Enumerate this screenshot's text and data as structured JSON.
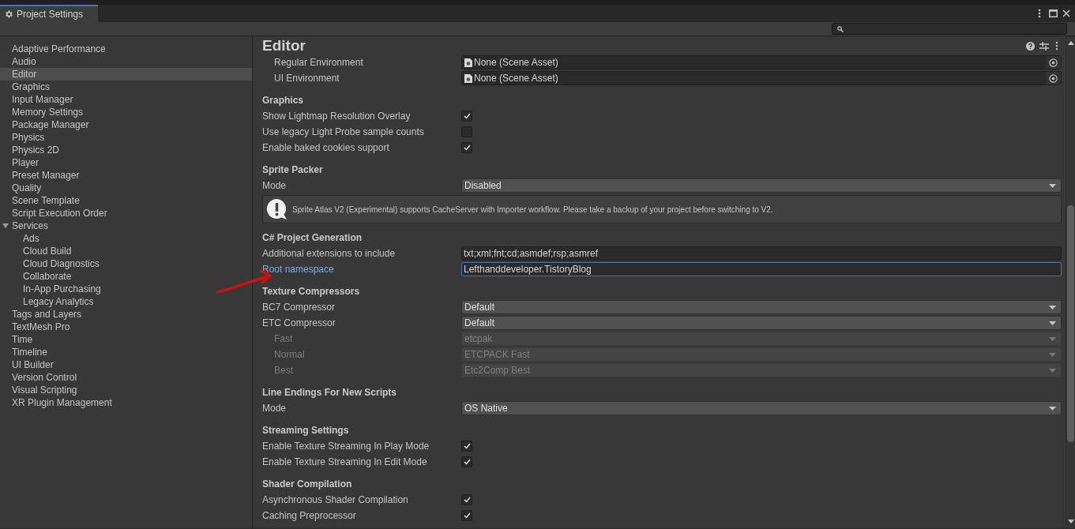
{
  "window": {
    "title": "Project Settings"
  },
  "sidebar": {
    "items": [
      {
        "label": "Adaptive Performance",
        "selected": false
      },
      {
        "label": "Audio",
        "selected": false
      },
      {
        "label": "Editor",
        "selected": true
      },
      {
        "label": "Graphics",
        "selected": false
      },
      {
        "label": "Input Manager",
        "selected": false
      },
      {
        "label": "Memory Settings",
        "selected": false
      },
      {
        "label": "Package Manager",
        "selected": false
      },
      {
        "label": "Physics",
        "selected": false
      },
      {
        "label": "Physics 2D",
        "selected": false
      },
      {
        "label": "Player",
        "selected": false
      },
      {
        "label": "Preset Manager",
        "selected": false
      },
      {
        "label": "Quality",
        "selected": false
      },
      {
        "label": "Scene Template",
        "selected": false
      },
      {
        "label": "Script Execution Order",
        "selected": false
      },
      {
        "label": "Services",
        "selected": false,
        "expanded": true,
        "children": [
          {
            "label": "Ads",
            "selected": false
          },
          {
            "label": "Cloud Build",
            "selected": false
          },
          {
            "label": "Cloud Diagnostics",
            "selected": false
          },
          {
            "label": "Collaborate",
            "selected": false
          },
          {
            "label": "In-App Purchasing",
            "selected": false
          },
          {
            "label": "Legacy Analytics",
            "selected": false
          }
        ]
      },
      {
        "label": "Tags and Layers",
        "selected": false
      },
      {
        "label": "TextMesh Pro",
        "selected": false
      },
      {
        "label": "Time",
        "selected": false
      },
      {
        "label": "Timeline",
        "selected": false
      },
      {
        "label": "UI Builder",
        "selected": false
      },
      {
        "label": "Version Control",
        "selected": false
      },
      {
        "label": "Visual Scripting",
        "selected": false
      },
      {
        "label": "XR Plugin Management",
        "selected": false
      }
    ]
  },
  "panel": {
    "title": "Editor",
    "sections": [
      {
        "rows": [
          {
            "kind": "object",
            "label": "Regular Environment",
            "value": "None (Scene Asset)",
            "indent": true
          },
          {
            "kind": "object",
            "label": "UI Environment",
            "value": "None (Scene Asset)",
            "indent": true
          }
        ]
      },
      {
        "header": "Graphics",
        "rows": [
          {
            "kind": "checkbox",
            "label": "Show Lightmap Resolution Overlay",
            "checked": true
          },
          {
            "kind": "checkbox",
            "label": "Use legacy Light Probe sample counts",
            "checked": false
          },
          {
            "kind": "checkbox",
            "label": "Enable baked cookies support",
            "checked": true
          }
        ]
      },
      {
        "header": "Sprite Packer",
        "rows": [
          {
            "kind": "dropdown",
            "label": "Mode",
            "value": "Disabled"
          },
          {
            "kind": "helpbox",
            "text": "Sprite Atlas V2 (Experimental) supports CacheServer with Importer workflow. Please take a backup of your project before switching to V2."
          }
        ]
      },
      {
        "header": "C# Project Generation",
        "rows": [
          {
            "kind": "text",
            "label": "Additional extensions to include",
            "value": "txt;xml;fnt;cd;asmdef;rsp;asmref",
            "focused": false
          },
          {
            "kind": "text",
            "label": "Root namespace",
            "value": "Lefthanddeveloper.TistoryBlog",
            "focused": true
          }
        ]
      },
      {
        "header": "Texture Compressors",
        "rows": [
          {
            "kind": "dropdown",
            "label": "BC7 Compressor",
            "value": "Default"
          },
          {
            "kind": "dropdown",
            "label": "ETC Compressor",
            "value": "Default"
          },
          {
            "kind": "dropdown",
            "label": "Fast",
            "value": "etcpak",
            "indent": true,
            "disabled": true
          },
          {
            "kind": "dropdown",
            "label": "Normal",
            "value": "ETCPACK Fast",
            "indent": true,
            "disabled": true
          },
          {
            "kind": "dropdown",
            "label": "Best",
            "value": "Etc2Comp Best",
            "indent": true,
            "disabled": true
          }
        ]
      },
      {
        "header": "Line Endings For New Scripts",
        "rows": [
          {
            "kind": "dropdown",
            "label": "Mode",
            "value": "OS Native"
          }
        ]
      },
      {
        "header": "Streaming Settings",
        "rows": [
          {
            "kind": "checkbox",
            "label": "Enable Texture Streaming In Play Mode",
            "checked": true
          },
          {
            "kind": "checkbox",
            "label": "Enable Texture Streaming In Edit Mode",
            "checked": true
          }
        ]
      },
      {
        "header": "Shader Compilation",
        "rows": [
          {
            "kind": "checkbox",
            "label": "Asynchronous Shader Compilation",
            "checked": true
          },
          {
            "kind": "checkbox",
            "label": "Caching Preprocessor",
            "checked": true
          }
        ]
      }
    ]
  }
}
